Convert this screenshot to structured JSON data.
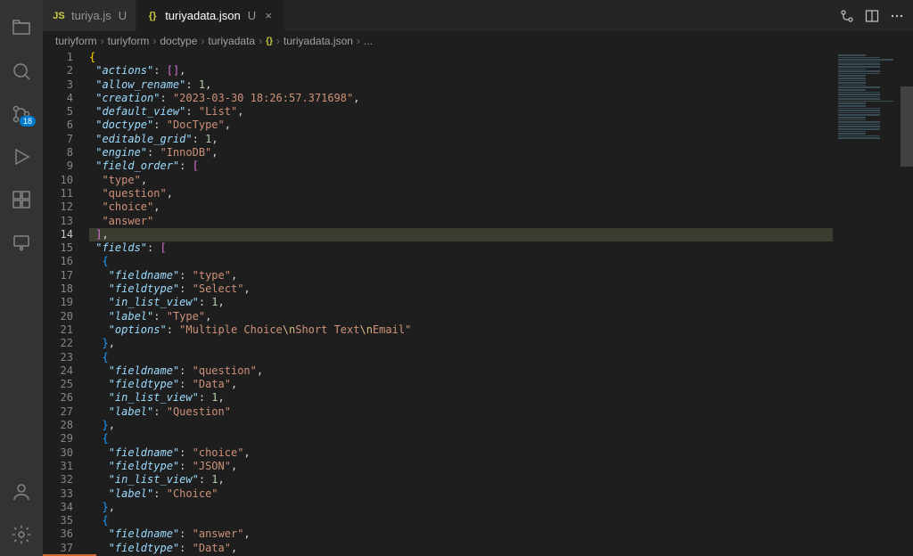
{
  "activity_bar": {
    "scm_badge": "18"
  },
  "tabs": [
    {
      "icon": "JS",
      "name": "turiya.js",
      "mod": "U",
      "active": false
    },
    {
      "icon": "{}",
      "name": "turiyadata.json",
      "mod": "U",
      "active": true
    }
  ],
  "breadcrumbs": [
    "turiyform",
    "turiyform",
    "doctype",
    "turiyadata",
    "{}",
    "turiyadata.json",
    "..."
  ],
  "current_line": 14,
  "code_lines": [
    {
      "n": 1,
      "html": "<span class='tok-brace'>{</span>"
    },
    {
      "n": 2,
      "html": " <span class='tok-key'>\"actions\"</span><span class='tok-punct'>: </span><span class='tok-brace2'>[]</span><span class='tok-punct'>,</span>"
    },
    {
      "n": 3,
      "html": " <span class='tok-key'>\"allow_rename\"</span><span class='tok-punct'>: </span><span class='tok-num'>1</span><span class='tok-punct'>,</span>"
    },
    {
      "n": 4,
      "html": " <span class='tok-key'>\"creation\"</span><span class='tok-punct'>: </span><span class='tok-str'>\"2023-03-30 18:26:57.371698\"</span><span class='tok-punct'>,</span>"
    },
    {
      "n": 5,
      "html": " <span class='tok-key'>\"default_view\"</span><span class='tok-punct'>: </span><span class='tok-str'>\"List\"</span><span class='tok-punct'>,</span>"
    },
    {
      "n": 6,
      "html": " <span class='tok-key'>\"doctype\"</span><span class='tok-punct'>: </span><span class='tok-str'>\"DocType\"</span><span class='tok-punct'>,</span>"
    },
    {
      "n": 7,
      "html": " <span class='tok-key'>\"editable_grid\"</span><span class='tok-punct'>: </span><span class='tok-num'>1</span><span class='tok-punct'>,</span>"
    },
    {
      "n": 8,
      "html": " <span class='tok-key'>\"engine\"</span><span class='tok-punct'>: </span><span class='tok-str'>\"InnoDB\"</span><span class='tok-punct'>,</span>"
    },
    {
      "n": 9,
      "html": " <span class='tok-key'>\"field_order\"</span><span class='tok-punct'>: </span><span class='tok-brace2'>[</span>"
    },
    {
      "n": 10,
      "html": "  <span class='tok-str'>\"type\"</span><span class='tok-punct'>,</span>"
    },
    {
      "n": 11,
      "html": "  <span class='tok-str'>\"question\"</span><span class='tok-punct'>,</span>"
    },
    {
      "n": 12,
      "html": "  <span class='tok-str'>\"choice\"</span><span class='tok-punct'>,</span>"
    },
    {
      "n": 13,
      "html": "  <span class='tok-str'>\"answer\"</span>"
    },
    {
      "n": 14,
      "html": " <span class='tok-brace2'>]</span><span class='tok-punct'>,</span>",
      "hl": true
    },
    {
      "n": 15,
      "html": " <span class='tok-key'>\"fields\"</span><span class='tok-punct'>: </span><span class='tok-brace2'>[</span>"
    },
    {
      "n": 16,
      "html": "  <span class='tok-brace3'>{</span>"
    },
    {
      "n": 17,
      "html": "   <span class='tok-key'>\"fieldname\"</span><span class='tok-punct'>: </span><span class='tok-str'>\"type\"</span><span class='tok-punct'>,</span>"
    },
    {
      "n": 18,
      "html": "   <span class='tok-key'>\"fieldtype\"</span><span class='tok-punct'>: </span><span class='tok-str'>\"Select\"</span><span class='tok-punct'>,</span>"
    },
    {
      "n": 19,
      "html": "   <span class='tok-key'>\"in_list_view\"</span><span class='tok-punct'>: </span><span class='tok-num'>1</span><span class='tok-punct'>,</span>"
    },
    {
      "n": 20,
      "html": "   <span class='tok-key'>\"label\"</span><span class='tok-punct'>: </span><span class='tok-str'>\"Type\"</span><span class='tok-punct'>,</span>"
    },
    {
      "n": 21,
      "html": "   <span class='tok-key'>\"options\"</span><span class='tok-punct'>: </span><span class='tok-str'>\"Multiple Choice</span><span class='tok-esc'>\\n</span><span class='tok-str'>Short Text</span><span class='tok-esc'>\\n</span><span class='tok-str'>Email\"</span>"
    },
    {
      "n": 22,
      "html": "  <span class='tok-brace3'>}</span><span class='tok-punct'>,</span>"
    },
    {
      "n": 23,
      "html": "  <span class='tok-brace3'>{</span>"
    },
    {
      "n": 24,
      "html": "   <span class='tok-key'>\"fieldname\"</span><span class='tok-punct'>: </span><span class='tok-str'>\"question\"</span><span class='tok-punct'>,</span>"
    },
    {
      "n": 25,
      "html": "   <span class='tok-key'>\"fieldtype\"</span><span class='tok-punct'>: </span><span class='tok-str'>\"Data\"</span><span class='tok-punct'>,</span>"
    },
    {
      "n": 26,
      "html": "   <span class='tok-key'>\"in_list_view\"</span><span class='tok-punct'>: </span><span class='tok-num'>1</span><span class='tok-punct'>,</span>"
    },
    {
      "n": 27,
      "html": "   <span class='tok-key'>\"label\"</span><span class='tok-punct'>: </span><span class='tok-str'>\"Question\"</span>"
    },
    {
      "n": 28,
      "html": "  <span class='tok-brace3'>}</span><span class='tok-punct'>,</span>"
    },
    {
      "n": 29,
      "html": "  <span class='tok-brace3'>{</span>"
    },
    {
      "n": 30,
      "html": "   <span class='tok-key'>\"fieldname\"</span><span class='tok-punct'>: </span><span class='tok-str'>\"choice\"</span><span class='tok-punct'>,</span>"
    },
    {
      "n": 31,
      "html": "   <span class='tok-key'>\"fieldtype\"</span><span class='tok-punct'>: </span><span class='tok-str'>\"JSON\"</span><span class='tok-punct'>,</span>"
    },
    {
      "n": 32,
      "html": "   <span class='tok-key'>\"in_list_view\"</span><span class='tok-punct'>: </span><span class='tok-num'>1</span><span class='tok-punct'>,</span>"
    },
    {
      "n": 33,
      "html": "   <span class='tok-key'>\"label\"</span><span class='tok-punct'>: </span><span class='tok-str'>\"Choice\"</span>"
    },
    {
      "n": 34,
      "html": "  <span class='tok-brace3'>}</span><span class='tok-punct'>,</span>"
    },
    {
      "n": 35,
      "html": "  <span class='tok-brace3'>{</span>"
    },
    {
      "n": 36,
      "html": "   <span class='tok-key'>\"fieldname\"</span><span class='tok-punct'>: </span><span class='tok-str'>\"answer\"</span><span class='tok-punct'>,</span>"
    },
    {
      "n": 37,
      "html": "   <span class='tok-key'>\"fieldtype\"</span><span class='tok-punct'>: </span><span class='tok-str'>\"Data\"</span><span class='tok-punct'>,</span>"
    }
  ]
}
